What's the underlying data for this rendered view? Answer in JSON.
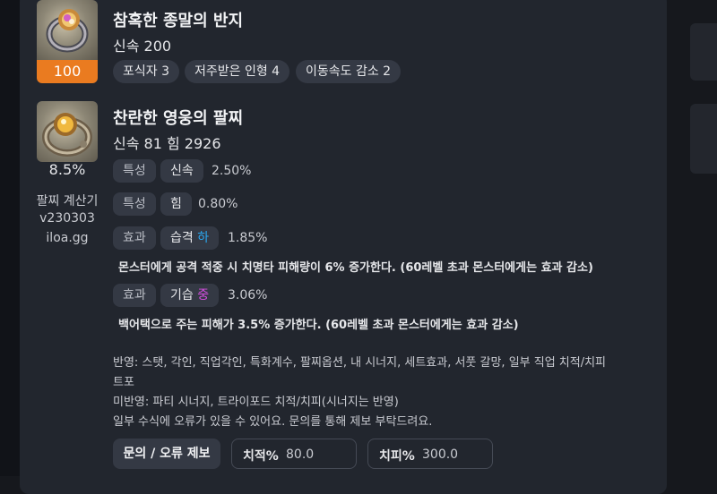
{
  "items": [
    {
      "name": "참혹한 종말의 반지",
      "stats": "신속 200",
      "level": "100",
      "tags": [
        "포식자 3",
        "저주받은 인형 4",
        "이동속도 감소 2"
      ]
    },
    {
      "name": "찬란한 영웅의 팔찌",
      "stats": "신속 81  힘 2926",
      "quality": "8.5%",
      "rows": [
        {
          "label": "특성",
          "name": "신속",
          "grade": "",
          "value": "2.50%"
        },
        {
          "label": "특성",
          "name": "힘",
          "grade": "",
          "value": "0.80%"
        },
        {
          "label": "효과",
          "name": "습격",
          "grade": "하",
          "value": "1.85%",
          "desc": "몬스터에게 공격 적중 시 치명타 피해량이 6% 증가한다. (60레벨 초과 몬스터에게는 효과 감소)"
        },
        {
          "label": "효과",
          "name": "기습",
          "grade": "중",
          "value": "3.06%",
          "desc": "백어택으로 주는 피해가 3.5% 증가한다. (60레벨 초과 몬스터에게는 효과 감소)"
        }
      ]
    }
  ],
  "calculator": {
    "title": "팔찌 계산기",
    "version": "v230303",
    "site": "iloa.gg"
  },
  "notes": {
    "line1": "반영: 스탯, 각인, 직업각인, 특화계수, 팔찌옵션, 내 시너지, 세트효과, 서풋 갈망, 일부 직업 치적/치피",
    "line1b": "트포",
    "line2": "미반영: 파티 시너지, 트라이포드 치적/치피(시너지는 반영)",
    "line3": "일부 수식에 오류가 있을 수 있어요. 문의를 통해 제보 부탁드려요."
  },
  "footer": {
    "report_button": "문의 / 오류 제보",
    "crit_label": "치적%",
    "crit_value": "80.0",
    "critdmg_label": "치피%",
    "critdmg_value": "300.0"
  },
  "colors": {
    "accent_orange": "#ea7b20",
    "grade_low": "#2aa7ef",
    "grade_mid": "#d64ee2"
  }
}
